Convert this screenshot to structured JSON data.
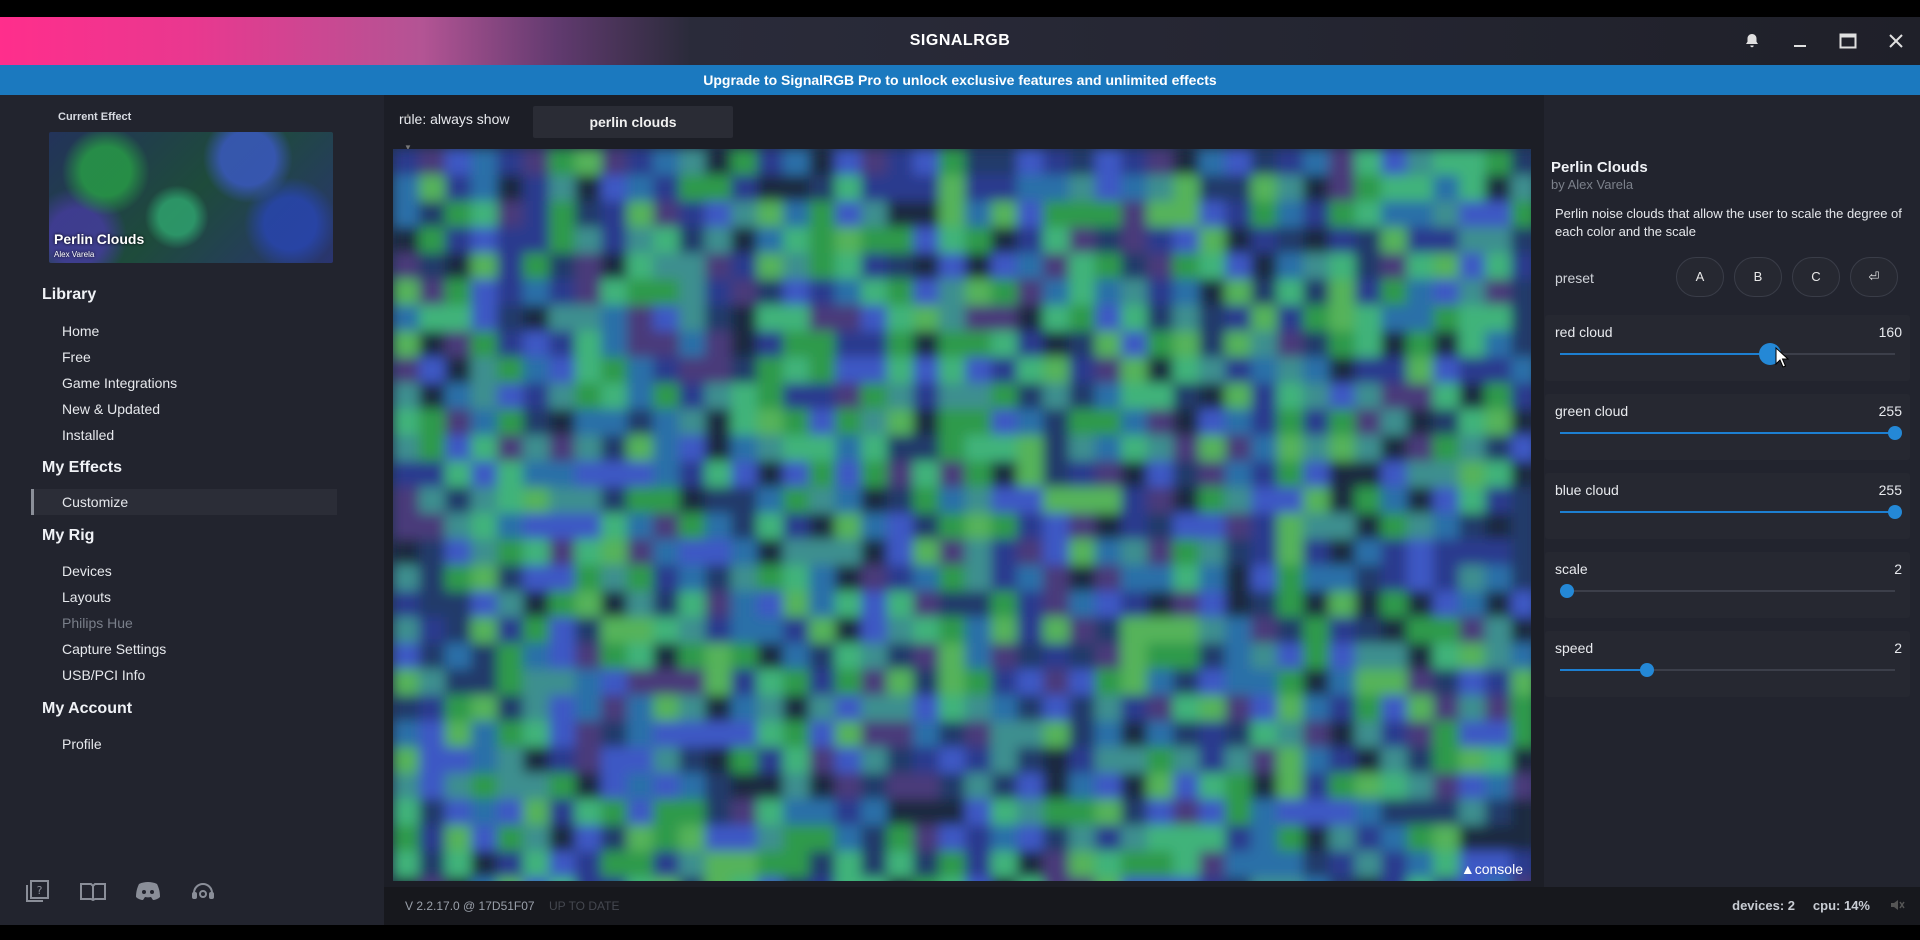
{
  "app": {
    "title": "SIGNALRGB",
    "banner": "Upgrade to SignalRGB Pro to unlock exclusive features and unlimited effects"
  },
  "window_controls": [
    "bell-icon",
    "minimize-icon",
    "maximize-icon",
    "close-icon"
  ],
  "sidebar": {
    "current_effect_label": "Current Effect",
    "current_effect_name": "Perlin Clouds",
    "current_effect_author": "Alex Varela",
    "sections": [
      {
        "title": "Library",
        "items": [
          "Home",
          "Free",
          "Game Integrations",
          "New & Updated",
          "Installed"
        ]
      },
      {
        "title": "My Effects",
        "items": [
          "Customize"
        ]
      },
      {
        "title": "My Rig",
        "items": [
          "Devices",
          "Layouts",
          "Philips Hue",
          "Capture Settings",
          "USB/PCI Info"
        ]
      },
      {
        "title": "My Account",
        "items": [
          "Profile"
        ]
      }
    ],
    "active_item": "Customize",
    "bottom_icons": [
      "help-icon",
      "book-icon",
      "discord-icon",
      "support-icon"
    ]
  },
  "main": {
    "rule_label": "rule: always show",
    "effect_tab": "perlin clouds",
    "console_label": "console"
  },
  "panel": {
    "title": "Perlin Clouds",
    "author": "by Alex Varela",
    "description": "Perlin noise clouds that allow the user to scale the degree of each color and the scale",
    "preset_label": "preset",
    "presets": [
      "A",
      "B",
      "C",
      "⏎"
    ],
    "params": [
      {
        "label": "red cloud",
        "value": "160",
        "fraction": 0.627
      },
      {
        "label": "green cloud",
        "value": "255",
        "fraction": 1.0
      },
      {
        "label": "blue cloud",
        "value": "255",
        "fraction": 1.0
      },
      {
        "label": "scale",
        "value": "2",
        "fraction": 0.02
      },
      {
        "label": "speed",
        "value": "2",
        "fraction": 0.26
      }
    ]
  },
  "status": {
    "version": "V 2.2.17.0 @ 17D51F07",
    "update": "UP TO DATE",
    "devices": "devices: 2",
    "cpu": "cpu: 14%"
  }
}
